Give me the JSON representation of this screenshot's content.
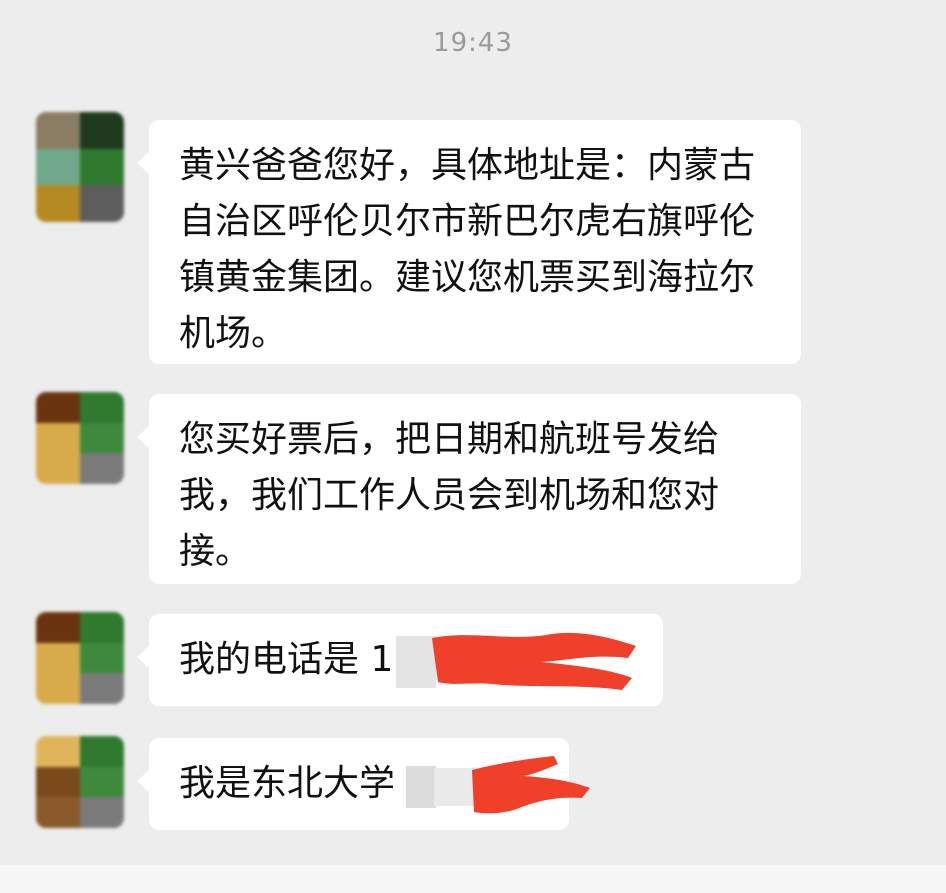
{
  "chat": {
    "timestamp": "19:43",
    "messages": [
      {
        "text": "黄兴爸爸您好，具体地址是：内蒙古自治区呼伦贝尔市新巴尔虎右旗呼伦镇黄金集团。建议您机票买到海拉尔机场。"
      },
      {
        "text": "您买好票后，把日期和航班号发给我，我们工作人员会到机场和您对接。"
      },
      {
        "text": "我的电话是 1"
      },
      {
        "text": "我是东北大学"
      }
    ]
  },
  "colors": {
    "background": "#ededed",
    "bubble": "#ffffff",
    "text": "#111111",
    "timestamp": "#9a9a9a",
    "redaction": "#f0402a"
  }
}
